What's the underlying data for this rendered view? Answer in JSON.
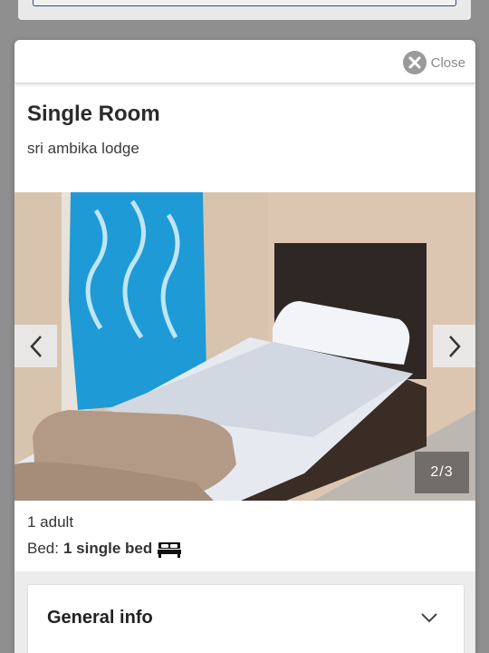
{
  "modal": {
    "close_label": "Close"
  },
  "room": {
    "title": "Single Room",
    "lodge": "sri ambika lodge",
    "occupancy": "1 adult",
    "bed_label": "Bed:",
    "bed_value": "1 single bed"
  },
  "gallery": {
    "counter": "2/3",
    "current": 2,
    "total": 3
  },
  "sections": {
    "general_info": "General info"
  },
  "icons": {
    "close": "close-circle-icon",
    "prev": "chevron-left-icon",
    "next": "chevron-right-icon",
    "bed": "bed-icon",
    "expand": "chevron-down-icon"
  },
  "colors": {
    "backdrop": "#8f8f8f",
    "text": "#2b2b2b",
    "close_icon": "#9a9a9a"
  }
}
